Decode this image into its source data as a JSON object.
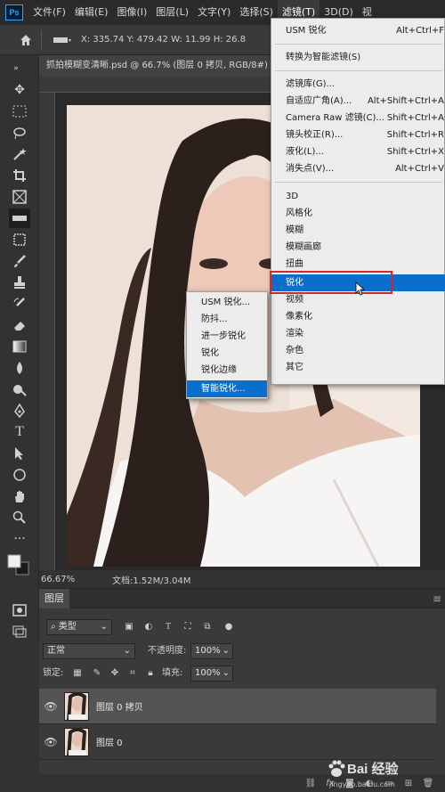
{
  "app": {
    "logo": "Ps"
  },
  "menubar": {
    "items": [
      "文件(F)",
      "编辑(E)",
      "图像(I)",
      "图层(L)",
      "文字(Y)",
      "选择(S)",
      "滤镜(T)",
      "3D(D)",
      "视"
    ],
    "active_index": 6
  },
  "options_bar": {
    "coords": "X: 335.74   Y: 479.42   W: 11.99   H: 26.8"
  },
  "document": {
    "tab_title": "抓拍模糊变清晰.psd @ 66.7% (图层 0 拷贝, RGB/8#) *"
  },
  "status": {
    "zoom": "66.67%",
    "doc_size": "文档:1.52M/3.04M"
  },
  "filter_menu": {
    "items": [
      {
        "label": "USM 锐化",
        "shortcut": "Alt+Ctrl+F"
      },
      {
        "label": "转换为智能滤镜(S)",
        "shortcut": ""
      },
      {
        "label": "滤镜库(G)...",
        "shortcut": ""
      },
      {
        "label": "自适应广角(A)...",
        "shortcut": "Alt+Shift+Ctrl+A"
      },
      {
        "label": "Camera Raw 滤镜(C)...",
        "shortcut": "Shift+Ctrl+A"
      },
      {
        "label": "镜头校正(R)...",
        "shortcut": "Shift+Ctrl+R"
      },
      {
        "label": "液化(L)...",
        "shortcut": "Shift+Ctrl+X"
      },
      {
        "label": "消失点(V)...",
        "shortcut": "Alt+Ctrl+V"
      },
      {
        "label": "3D",
        "shortcut": ""
      },
      {
        "label": "风格化",
        "shortcut": ""
      },
      {
        "label": "模糊",
        "shortcut": ""
      },
      {
        "label": "模糊画廊",
        "shortcut": ""
      },
      {
        "label": "扭曲",
        "shortcut": ""
      },
      {
        "label": "锐化",
        "shortcut": ""
      },
      {
        "label": "视频",
        "shortcut": ""
      },
      {
        "label": "像素化",
        "shortcut": ""
      },
      {
        "label": "渲染",
        "shortcut": ""
      },
      {
        "label": "杂色",
        "shortcut": ""
      },
      {
        "label": "其它",
        "shortcut": ""
      }
    ],
    "highlighted_index": 13
  },
  "sharpen_submenu": {
    "items": [
      "USM 锐化...",
      "防抖...",
      "进一步锐化",
      "锐化",
      "锐化边缘",
      "智能锐化..."
    ],
    "highlighted_index": 5
  },
  "layers_panel": {
    "tab": "图层",
    "filter_kind": "类型",
    "blend_mode": "正常",
    "opacity_label": "不透明度:",
    "opacity_value": "100%",
    "lock_label": "锁定:",
    "fill_label": "填充:",
    "fill_value": "100%",
    "layers": [
      {
        "name": "图层 0 拷贝",
        "selected": true
      },
      {
        "name": "图层 0",
        "selected": false
      }
    ]
  },
  "watermark": {
    "brand": "Bai 经验",
    "url": "jingyan.baidu.com"
  },
  "colors": {
    "accent": "#0a6ecd",
    "highlight_border": "#d42a2a"
  }
}
